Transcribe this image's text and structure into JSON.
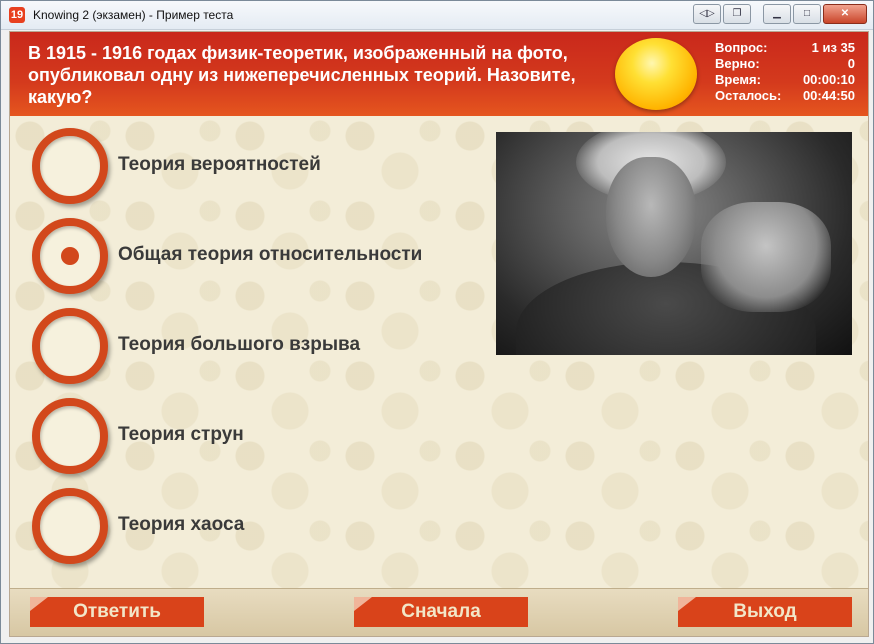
{
  "window": {
    "title": "Knowing 2 (экзамен) - Пример теста",
    "app_icon_glyph": "19",
    "buttons": [
      "back-forward-icon",
      "restore-icon",
      "minimize-icon",
      "maximize-icon",
      "close-icon"
    ]
  },
  "header": {
    "question": "В 1915 - 1916 годах физик-теоретик, изображенный на фото, опубликовал одну из нижеперечисленных теорий. Назовите, какую?",
    "stats": [
      {
        "label": "Вопрос:",
        "value": "1 из 35"
      },
      {
        "label": "Верно:",
        "value": "0"
      },
      {
        "label": "Время:",
        "value": "00:00:10"
      },
      {
        "label": "Осталось:",
        "value": "00:44:50"
      }
    ]
  },
  "options": [
    {
      "label": "Теория вероятностей",
      "selected": false
    },
    {
      "label": "Общая теория относительности",
      "selected": true
    },
    {
      "label": "Теория большого взрыва",
      "selected": false
    },
    {
      "label": "Теория струн",
      "selected": false
    },
    {
      "label": "Теория хаоса",
      "selected": false
    }
  ],
  "footer": {
    "answer_label": "Ответить",
    "restart_label": "Сначала",
    "exit_label": "Выход"
  },
  "colors": {
    "header_red": "#c9281b",
    "accent_orange": "#d2481c",
    "background_cream": "#f3edd8"
  }
}
